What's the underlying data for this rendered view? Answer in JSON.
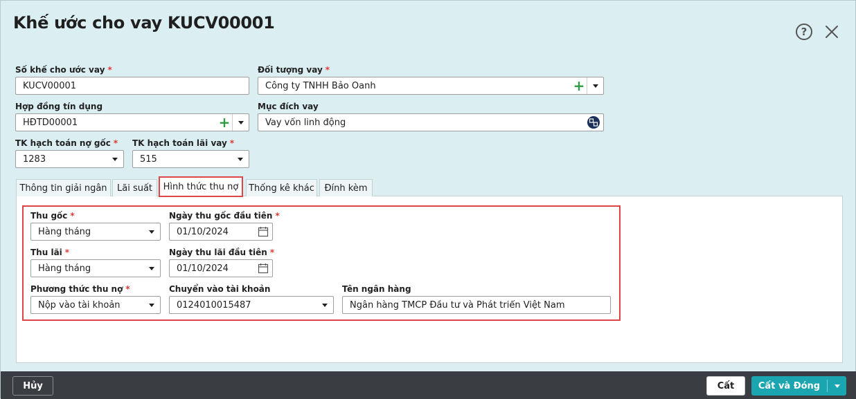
{
  "dialog": {
    "title": "Khế ước cho vay KUCV00001",
    "help_label": "?"
  },
  "form": {
    "contract_no": {
      "label": "Số khế cho ước vay",
      "value": "KUCV00001"
    },
    "borrower": {
      "label": "Đối tượng vay",
      "value": "Công ty TNHH Bảo Oanh"
    },
    "credit_contract": {
      "label": "Hợp đồng tín dụng",
      "value": "HĐTD00001"
    },
    "purpose": {
      "label": "Mục đích vay",
      "value": "Vay vốn linh động"
    },
    "principal_account": {
      "label": "TK hạch toán nợ gốc",
      "value": "1283"
    },
    "interest_account": {
      "label": "TK hạch toán lãi vay",
      "value": "515"
    },
    "required_mark": "*"
  },
  "tabs": [
    {
      "label": "Thông tin giải ngân"
    },
    {
      "label": "Lãi suất"
    },
    {
      "label": "Hình thức thu nợ"
    },
    {
      "label": "Thống kê khác"
    },
    {
      "label": "Đính kèm"
    }
  ],
  "repayment": {
    "principal_collection": {
      "label": "Thu gốc",
      "value": "Hàng tháng"
    },
    "first_principal_date": {
      "label": "Ngày thu gốc đầu tiên",
      "value": "01/10/2024"
    },
    "interest_collection": {
      "label": "Thu lãi",
      "value": "Hàng tháng"
    },
    "first_interest_date": {
      "label": "Ngày thu lãi đầu tiên",
      "value": "01/10/2024"
    },
    "method": {
      "label": "Phương thức thu nợ",
      "value": "Nộp vào tài khoản"
    },
    "to_account": {
      "label": "Chuyển vào tài khoản",
      "value": "0124010015487"
    },
    "bank_name": {
      "label": "Tên ngân hàng",
      "value": "Ngân hàng TMCP Đầu tư và Phát triển Việt Nam"
    }
  },
  "footer": {
    "cancel_label": "Hủy",
    "save_label": "Cất",
    "save_close_label": "Cất và Đóng"
  },
  "colors": {
    "background": "#dbeef2",
    "highlight": "#e04545",
    "primary": "#1aa5b1",
    "footer": "#3a3d42",
    "add": "#2e9b3f"
  }
}
